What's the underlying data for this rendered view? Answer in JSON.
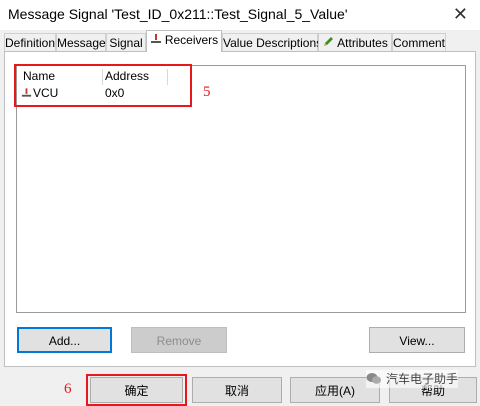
{
  "window": {
    "title": "Message Signal 'Test_ID_0x211::Test_Signal_5_Value'",
    "close_glyph": "✕"
  },
  "tabs": [
    {
      "label": "Definition"
    },
    {
      "label": "Message"
    },
    {
      "label": "Signal"
    },
    {
      "label": "Receivers",
      "active": true,
      "icon": "receiver-node-icon"
    },
    {
      "label": "Value Descriptions"
    },
    {
      "label": "Attributes",
      "icon": "pencil-icon"
    },
    {
      "label": "Comment"
    }
  ],
  "receivers": {
    "columns": [
      "Name",
      "Address"
    ],
    "rows": [
      {
        "name": "VCU",
        "address": "0x0",
        "icon": "receiver-node-icon"
      }
    ]
  },
  "buttons": {
    "add": "Add...",
    "remove": "Remove",
    "view": "View..."
  },
  "footer": {
    "ok": "确定",
    "cancel": "取消",
    "apply": "应用(A)",
    "help": "帮助"
  },
  "annotations": {
    "five": "5",
    "six": "6"
  },
  "watermark": {
    "text": "汽车电子助手",
    "icon": "wechat-icon"
  },
  "colors": {
    "annotation": "#e8161d",
    "accent": "#0078d7"
  }
}
